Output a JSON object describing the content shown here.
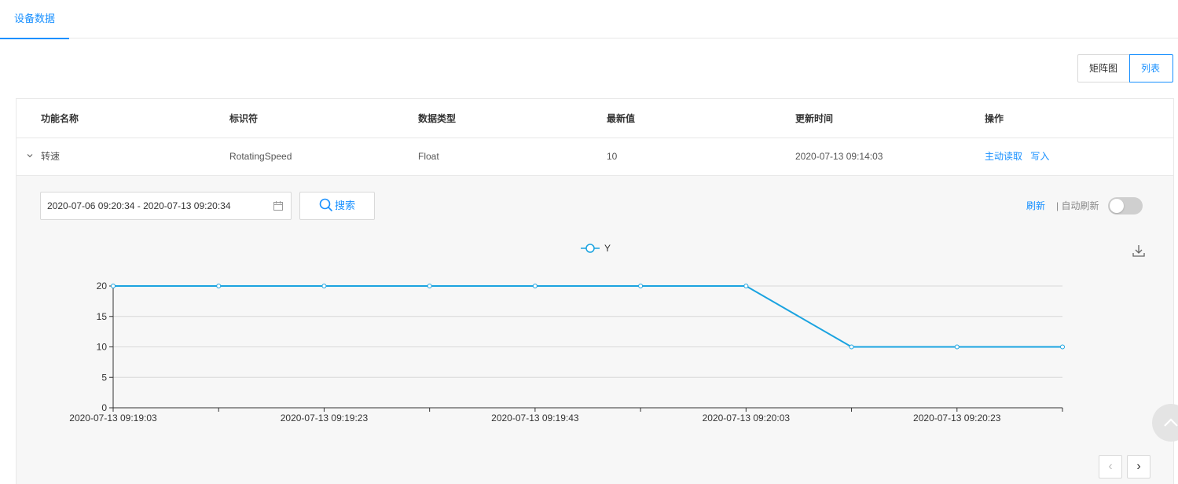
{
  "tabs": [
    {
      "label": "设备数据",
      "active": true
    }
  ],
  "view_switch": {
    "matrix_label": "矩阵图",
    "list_label": "列表",
    "active": "list"
  },
  "table": {
    "columns": [
      "功能名称",
      "标识符",
      "数据类型",
      "最新值",
      "更新时间",
      "操作"
    ],
    "rows": [
      {
        "name": "转速",
        "identifier": "RotatingSpeed",
        "data_type": "Float",
        "latest_value": "10",
        "updated_at": "2020-07-13 09:14:03",
        "actions": {
          "read": "主动读取",
          "write": "写入"
        }
      }
    ]
  },
  "expanded": {
    "date_range": "2020-07-06 09:20:34 - 2020-07-13 09:20:34",
    "search_label": "搜索",
    "refresh_label": "刷新",
    "auto_refresh_label": "| 自动刷新",
    "auto_refresh_on": false
  },
  "chart_data": {
    "type": "line",
    "legend": [
      "Y"
    ],
    "series": [
      {
        "name": "Y",
        "color": "#1aa3e0",
        "x": [
          "2020-07-13 09:19:03",
          "2020-07-13 09:19:13",
          "2020-07-13 09:19:23",
          "2020-07-13 09:19:33",
          "2020-07-13 09:19:43",
          "2020-07-13 09:19:53",
          "2020-07-13 09:20:03",
          "2020-07-13 09:20:13",
          "2020-07-13 09:20:23",
          "2020-07-13 09:20:33"
        ],
        "values": [
          20,
          20,
          20,
          20,
          20,
          20,
          20,
          10,
          10,
          10
        ]
      }
    ],
    "x_tick_labels": [
      "2020-07-13 09:19:03",
      "2020-07-13 09:19:23",
      "2020-07-13 09:19:43",
      "2020-07-13 09:20:03",
      "2020-07-13 09:20:23"
    ],
    "y_ticks": [
      0,
      5,
      10,
      15,
      20
    ],
    "ylim": [
      0,
      20
    ],
    "grid": true,
    "legend_position": "top"
  },
  "colors": {
    "accent": "#1890ff",
    "line": "#1aa3e0"
  }
}
